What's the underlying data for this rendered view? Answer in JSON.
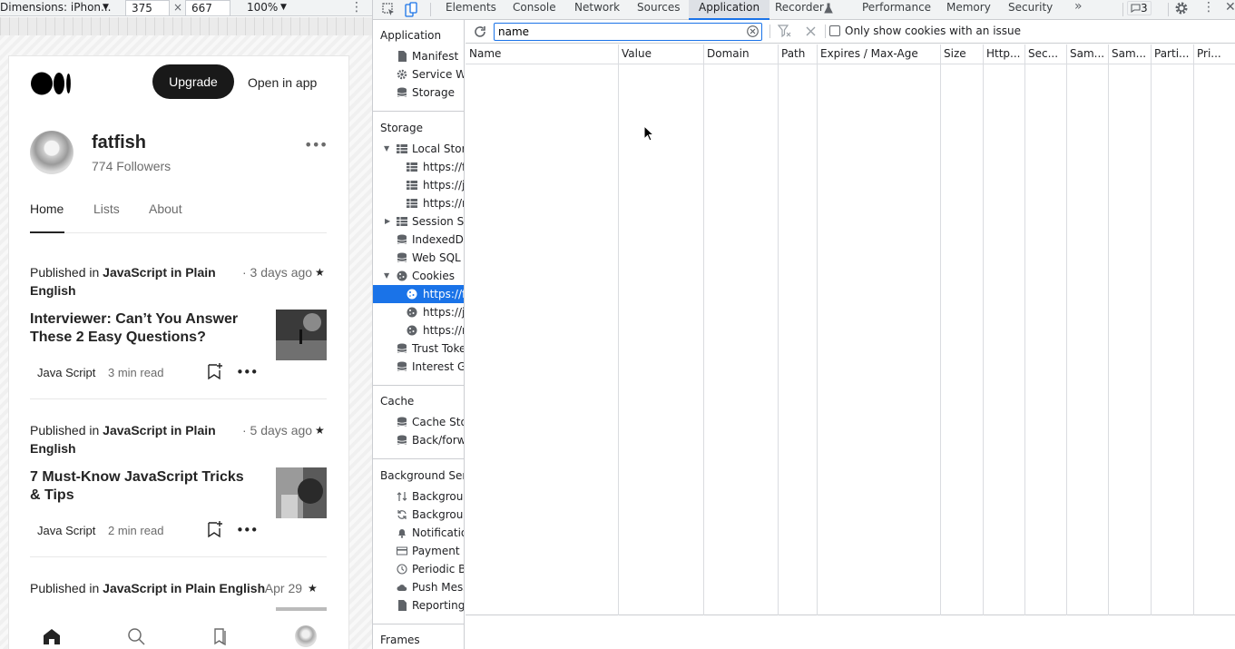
{
  "device_toolbar": {
    "dimensions_label": "Dimensions: iPhon...",
    "width": "375",
    "times": "×",
    "height": "667",
    "zoom": "100%"
  },
  "medium": {
    "upgrade_label": "Upgrade",
    "open_in_app_label": "Open in app",
    "username": "fatfish",
    "followers": "774 Followers",
    "tabs": [
      "Home",
      "Lists",
      "About"
    ],
    "articles": [
      {
        "published_prefix": "Published in",
        "publication_line1": "JavaScript in Plain",
        "publication_line2": "English",
        "date": "· 3 days ago",
        "title": "Interviewer: Can’t You Answer These 2 Easy Questions?",
        "tag": "Java Script",
        "read_time": "3 min read"
      },
      {
        "published_prefix": "Published in",
        "publication_line1": "JavaScript in Plain",
        "publication_line2": "English",
        "date": "· 5 days ago",
        "title": "7 Must-Know JavaScript Tricks & Tips",
        "tag": "Java Script",
        "read_time": "2 min read"
      },
      {
        "published_prefix": "Published in",
        "publication_line1": "JavaScript in Plain English",
        "date": "· Apr 29"
      }
    ]
  },
  "devtools": {
    "tabs": [
      "Elements",
      "Console",
      "Network",
      "Sources",
      "Application",
      "Recorder",
      "Performance",
      "Memory",
      "Security"
    ],
    "overflow": "»",
    "issues_count": "3",
    "sidebar": {
      "application_header": "Application",
      "application_items": [
        "Manifest",
        "Service Wo",
        "Storage"
      ],
      "storage_header": "Storage",
      "local_storage": "Local Stora",
      "local_storage_children": [
        "https://fa",
        "https://js",
        "https://m"
      ],
      "session_storage": "Session St",
      "storage_items": [
        "IndexedDE",
        "Web SQL"
      ],
      "cookies": "Cookies",
      "cookies_children": [
        "https://fa",
        "https://js",
        "https://m"
      ],
      "storage_items2": [
        "Trust Toker",
        "Interest Gr"
      ],
      "cache_header": "Cache",
      "cache_items": [
        "Cache Sto",
        "Back/forwa"
      ],
      "bg_header": "Background Serv",
      "bg_items": [
        "Backgroun",
        "Backgroun",
        "Notificatio",
        "Payment H",
        "Periodic Ba",
        "Push Mess",
        "Reporting /"
      ],
      "frames_header": "Frames"
    },
    "filter": {
      "value": "name",
      "only_issue_label": "Only show cookies with an issue"
    },
    "columns": [
      "Name",
      "Value",
      "Domain",
      "Path",
      "Expires / Max-Age",
      "Size",
      "Http...",
      "Sec...",
      "Sam...",
      "Sam...",
      "Parti...",
      "Pri..."
    ]
  }
}
